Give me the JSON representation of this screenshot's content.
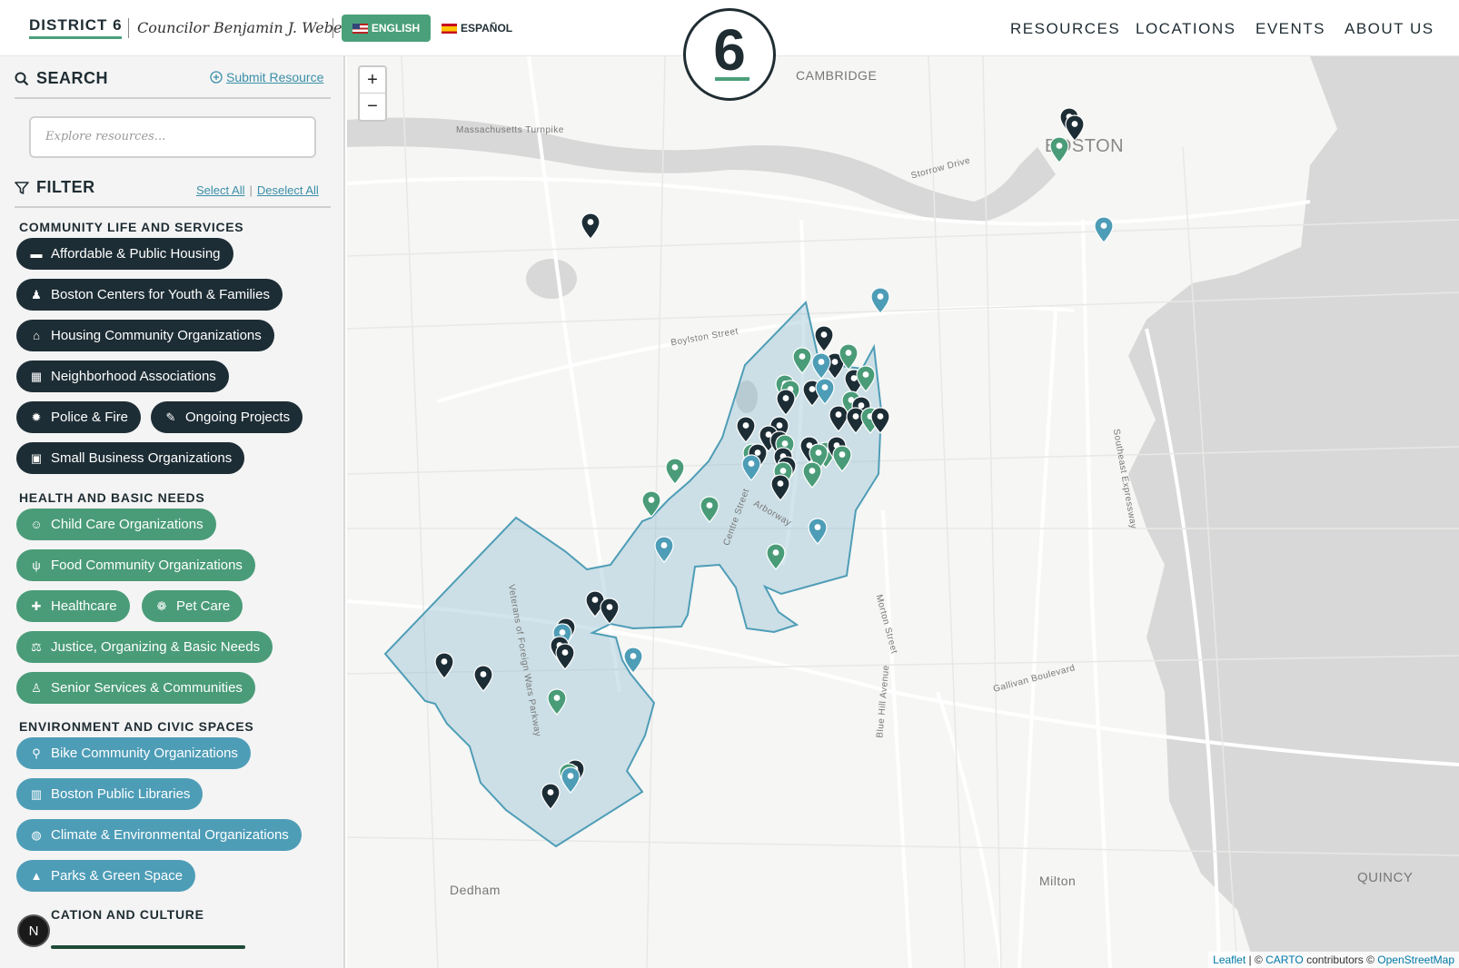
{
  "header": {
    "district": "DISTRICT 6",
    "councilor": "Councilor Benjamin J. Weber",
    "lang_english": "ENGLISH",
    "lang_spanish": "ESPAÑOL",
    "logo_number": "6",
    "nav": [
      "RESOURCES",
      "LOCATIONS",
      "EVENTS",
      "ABOUT US"
    ]
  },
  "sidebar": {
    "search_title": "SEARCH",
    "submit_resource": "Submit Resource",
    "search_placeholder": "Explore resources...",
    "filter_title": "FILTER",
    "select_all": "Select All",
    "deselect_all": "Deselect All",
    "groups": [
      {
        "title": "COMMUNITY LIFE AND SERVICES",
        "color": "#1d2d35",
        "items": [
          "Affordable & Public Housing",
          "Boston Centers for Youth & Families",
          "Housing Community Organizations",
          "Neighborhood Associations",
          "Police & Fire",
          "Ongoing Projects",
          "Small Business Organizations"
        ]
      },
      {
        "title": "HEALTH AND BASIC NEEDS",
        "color": "#4a9c78",
        "items": [
          "Child Care Organizations",
          "Food Community Organizations",
          "Healthcare",
          "Pet Care",
          "Justice, Organizing & Basic Needs",
          "Senior Services & Communities"
        ]
      },
      {
        "title": "ENVIRONMENT AND CIVIC SPACES",
        "color": "#4e9db7",
        "items": [
          "Bike Community Organizations",
          "Boston Public Libraries",
          "Climate & Environmental Organizations",
          "Parks & Green Space"
        ]
      },
      {
        "title": "CATION AND CULTURE",
        "color": "#1d4a37",
        "items": []
      }
    ],
    "badge": "N"
  },
  "map": {
    "zoom_in": "+",
    "zoom_out": "−",
    "labels": [
      "CAMBRIDGE",
      "BOSTON",
      "Dedham",
      "Milton",
      "QUINCY",
      "Massachusetts Turnpike",
      "Boylston Street",
      "Storrow Drive",
      "Arborway",
      "Centre Street",
      "Gallivan Boulevard",
      "Blue Hill Avenue",
      "Southeast Expressway",
      "Morton Street",
      "Veterans of Foreign Wars Parkway"
    ],
    "attribution": {
      "leaflet": "Leaflet",
      "carto": "CARTO",
      "contributors": "contributors ©",
      "osm": "OpenStreetMap"
    }
  },
  "colors": {
    "dark": "#1d2d35",
    "green": "#4a9c78",
    "teal": "#4e9db7",
    "accent": "#4aa07a"
  }
}
